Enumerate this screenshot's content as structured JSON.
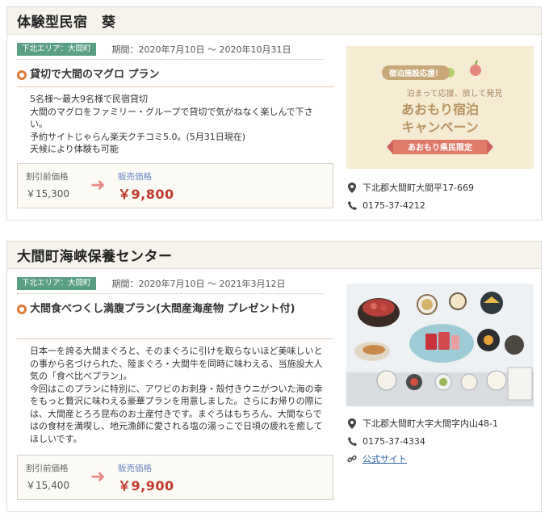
{
  "listings": [
    {
      "title": "体験型民宿　葵",
      "area_badge": "下北エリア：大間町",
      "period": "期間：2020年7月10日 〜 2020年10月31日",
      "plan_title": "貸切で大間のマグロ プラン",
      "description": [
        "5名様〜最大9名様で民宿貸切",
        "大間のマグロをファミリー・グループで貸切で気がねなく楽しんで下さい。",
        "予約サイトじゃらん楽天クチコミ5.0。(5月31日現在)",
        "天候により体験も可能"
      ],
      "price": {
        "original_label": "割引前価格",
        "original": "￥15,300",
        "sale_label": "販売価格",
        "sale": "￥9,800"
      },
      "promo": {
        "badge": "宿泊施設応援！",
        "line1": "泊まって応援、旅して発見",
        "line2": "あおもり宿泊",
        "line3": "キャンペーン",
        "ribbon": "あおもり県民限定"
      },
      "address": "下北郡大間町大間平17-669",
      "phone": "0175-37-4212"
    },
    {
      "title": "大間町海峡保養センター",
      "area_badge": "下北エリア：大間町",
      "period": "期間：2020年7月10日 〜 2021年3月12日",
      "plan_title": "大間食べつくし満腹プラン(大間産海産物 プレゼント付)",
      "description": [
        "日本一を誇る大間まぐろと、そのまぐろに引けを取らないほど美味しいとの事から名づけられた、陸まぐろ・大間牛を同時に味わえる、当施設大人気の「食べ比べプラン」。",
        "今回はこのプランに特別に、アワビのお刺身・殻付きウニがついた海の幸をもっと贅沢に味わえる豪華プランを用意しました。さらにお帰りの際には、大間産とろろ昆布のお土産付きです。まぐろはもちろん、大間ならではの食材を満喫し、地元漁師に愛される塩の湯っこで日頃の疲れを癒してほしいです。"
      ],
      "price": {
        "original_label": "割引前価格",
        "original": "￥15,400",
        "sale_label": "販売価格",
        "sale": "￥9,900"
      },
      "address": "下北郡大間町大字大間字内山48-1",
      "phone": "0175-37-4334",
      "website_label": "公式サイト"
    }
  ],
  "icons": {
    "location": "map-pin-icon",
    "phone": "phone-icon",
    "link": "link-icon",
    "arrow": "arrow-right-icon"
  },
  "colors": {
    "badge_green": "#5a9e84",
    "sale_red": "#c0392b",
    "bullet_orange": "#e07a3a",
    "link_blue": "#3366aa"
  }
}
